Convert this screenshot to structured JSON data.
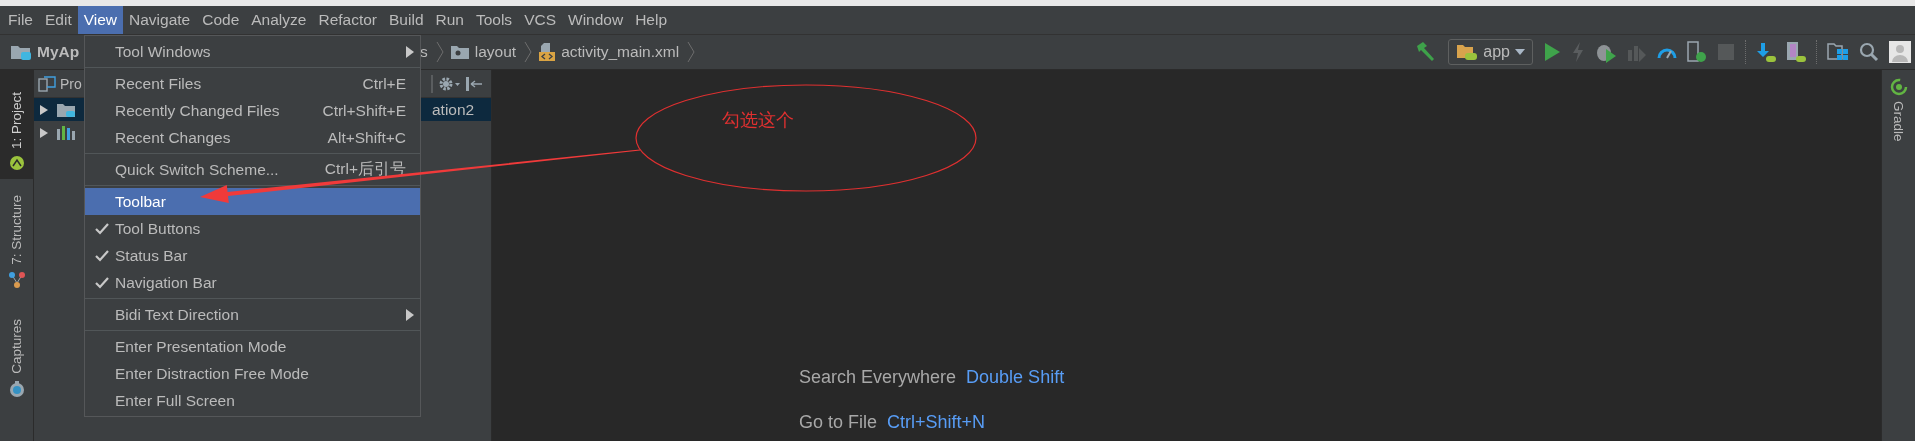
{
  "menu_bar": {
    "items": [
      {
        "label": "File",
        "selected": false
      },
      {
        "label": "Edit",
        "selected": false
      },
      {
        "label": "View",
        "selected": true
      },
      {
        "label": "Navigate",
        "selected": false
      },
      {
        "label": "Code",
        "selected": false
      },
      {
        "label": "Analyze",
        "selected": false
      },
      {
        "label": "Refactor",
        "selected": false
      },
      {
        "label": "Build",
        "selected": false
      },
      {
        "label": "Run",
        "selected": false
      },
      {
        "label": "Tools",
        "selected": false
      },
      {
        "label": "VCS",
        "selected": false
      },
      {
        "label": "Window",
        "selected": false
      },
      {
        "label": "Help",
        "selected": false
      }
    ]
  },
  "navigation_bar": {
    "crumbs": [
      {
        "label": "MyAp",
        "kind": "project"
      },
      {
        "label": "s",
        "kind": "hidden"
      },
      {
        "label": "layout",
        "kind": "folder"
      },
      {
        "label": "activity_main.xml",
        "kind": "xml-file"
      }
    ],
    "run_configuration": "app"
  },
  "tool_window_strip": {
    "left": [
      {
        "label": "1: Project",
        "selected": true,
        "kind": "android"
      },
      {
        "label": "7: Structure",
        "selected": false,
        "kind": "structure"
      },
      {
        "label": "Captures",
        "selected": false,
        "kind": "captures"
      }
    ],
    "right": [
      {
        "label": "Gradle",
        "selected": false
      }
    ]
  },
  "project_panel": {
    "title": "Pro",
    "rows": [
      {
        "label": "ation2",
        "kind": "module",
        "selected": true,
        "expanded": false
      },
      {
        "kind": "libraries",
        "selected": false,
        "expanded": false
      }
    ]
  },
  "view_menu": {
    "groups": [
      {
        "items": [
          {
            "label": "Tool Windows",
            "kind": "submenu",
            "selected": false
          }
        ]
      },
      {
        "items": [
          {
            "label": "Recent Files",
            "kind": "command",
            "shortcut": "Ctrl+E",
            "selected": false
          },
          {
            "label": "Recently Changed Files",
            "kind": "command",
            "shortcut": "Ctrl+Shift+E",
            "selected": false
          },
          {
            "label": "Recent Changes",
            "kind": "command",
            "shortcut": "Alt+Shift+C",
            "selected": false
          }
        ]
      },
      {
        "items": [
          {
            "label": "Quick Switch Scheme...",
            "kind": "command",
            "shortcut": "Ctrl+后引号",
            "selected": false
          }
        ]
      },
      {
        "items": [
          {
            "label": "Toolbar",
            "kind": "toggle",
            "checked": false,
            "selected": true
          },
          {
            "label": "Tool Buttons",
            "kind": "toggle",
            "checked": true,
            "selected": false
          },
          {
            "label": "Status Bar",
            "kind": "toggle",
            "checked": true,
            "selected": false
          },
          {
            "label": "Navigation Bar",
            "kind": "toggle",
            "checked": true,
            "selected": false
          }
        ]
      },
      {
        "items": [
          {
            "label": "Bidi Text Direction",
            "kind": "submenu",
            "selected": false
          }
        ]
      },
      {
        "items": [
          {
            "label": "Enter Presentation Mode",
            "kind": "command",
            "selected": false
          },
          {
            "label": "Enter Distraction Free Mode",
            "kind": "command",
            "selected": false
          },
          {
            "label": "Enter Full Screen",
            "kind": "command",
            "selected": false
          }
        ]
      }
    ]
  },
  "editor": {
    "hints": [
      {
        "action": "Search Everywhere",
        "shortcut": "Double Shift"
      },
      {
        "action": "Go to File",
        "shortcut": "Ctrl+Shift+N"
      }
    ]
  },
  "annotation": {
    "text": "勾选这个"
  }
}
